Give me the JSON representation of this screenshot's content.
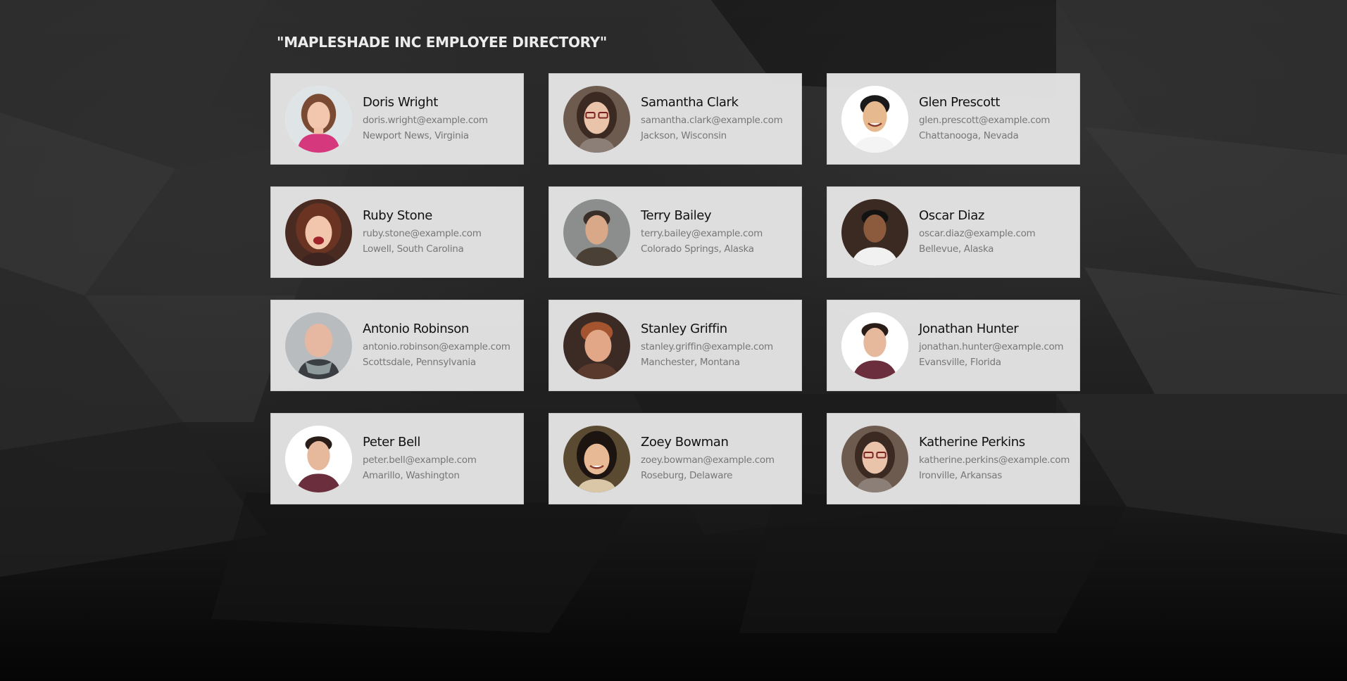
{
  "title": "\"MAPLESHADE INC EMPLOYEE DIRECTORY\"",
  "employees": [
    {
      "name": "Doris Wright",
      "email": "doris.wright@example.com",
      "location": "Newport News, Virginia"
    },
    {
      "name": "Samantha Clark",
      "email": "samantha.clark@example.com",
      "location": "Jackson, Wisconsin"
    },
    {
      "name": "Glen Prescott",
      "email": "glen.prescott@example.com",
      "location": "Chattanooga, Nevada"
    },
    {
      "name": "Ruby Stone",
      "email": "ruby.stone@example.com",
      "location": "Lowell, South Carolina"
    },
    {
      "name": "Terry Bailey",
      "email": "terry.bailey@example.com",
      "location": "Colorado Springs, Alaska"
    },
    {
      "name": "Oscar Diaz",
      "email": "oscar.diaz@example.com",
      "location": "Bellevue, Alaska"
    },
    {
      "name": "Antonio Robinson",
      "email": "antonio.robinson@example.com",
      "location": "Scottsdale, Pennsylvania"
    },
    {
      "name": "Stanley Griffin",
      "email": "stanley.griffin@example.com",
      "location": "Manchester, Montana"
    },
    {
      "name": "Jonathan Hunter",
      "email": "jonathan.hunter@example.com",
      "location": "Evansville, Florida"
    },
    {
      "name": "Peter Bell",
      "email": "peter.bell@example.com",
      "location": "Amarillo, Washington"
    },
    {
      "name": "Zoey Bowman",
      "email": "zoey.bowman@example.com",
      "location": "Roseburg, Delaware"
    },
    {
      "name": "Katherine Perkins",
      "email": "katherine.perkins@example.com",
      "location": "Ironville, Arkansas"
    }
  ]
}
